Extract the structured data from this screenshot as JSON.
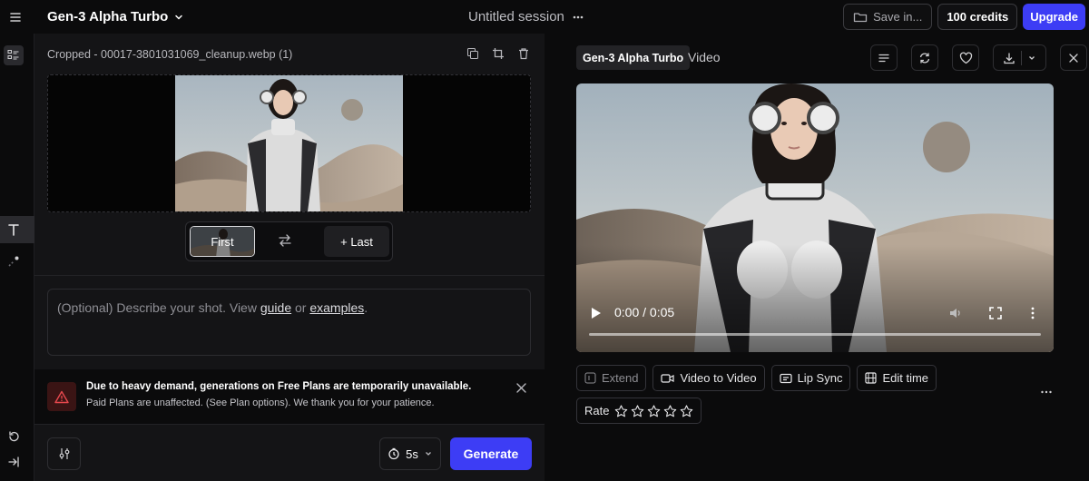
{
  "topbar": {
    "model": "Gen-3 Alpha Turbo",
    "session": "Untitled session",
    "save": "Save in...",
    "credits": "100 credits",
    "upgrade": "Upgrade"
  },
  "left": {
    "filename": "Cropped - 00017-3801031069_cleanup.webp (1)",
    "frame_first": "First",
    "frame_last": "+ Last",
    "prompt": {
      "before": "(Optional) Describe your shot. View ",
      "guide": "guide",
      "or": " or ",
      "examples": "examples",
      "end": "."
    },
    "notice": {
      "title": "Due to heavy demand, generations on Free Plans are temporarily unavailable.",
      "subtitle": "Paid Plans are unaffected. (See Plan options). We thank you for your patience."
    },
    "duration": "5s",
    "generate": "Generate"
  },
  "right": {
    "model": "Gen-3 Alpha Turbo",
    "type": "Video",
    "time": "0:00 / 0:05",
    "actions": [
      "Extend",
      "Video to Video",
      "Lip Sync",
      "Edit time"
    ],
    "rate": "Rate",
    "rating": 0,
    "rating_max": 5
  },
  "colors": {
    "accent": "#3d3df5",
    "panel": "#141416",
    "background": "#0b0b0c",
    "warning": "#e5484d"
  },
  "icons": [
    "menu-icon",
    "chevron-down-icon",
    "more-horizontal-icon",
    "folder-icon",
    "library-icon",
    "text-icon",
    "brush-icon",
    "undo-icon",
    "collapse-icon",
    "copy-icon",
    "crop-icon",
    "trash-icon",
    "swap-icon",
    "warning-icon",
    "close-icon",
    "sliders-icon",
    "clock-icon",
    "list-icon",
    "refresh-icon",
    "heart-icon",
    "download-icon",
    "play-icon",
    "volume-icon",
    "fullscreen-icon",
    "more-vertical-icon",
    "video-camera-icon",
    "lip-sync-icon",
    "film-icon",
    "star-icon"
  ]
}
